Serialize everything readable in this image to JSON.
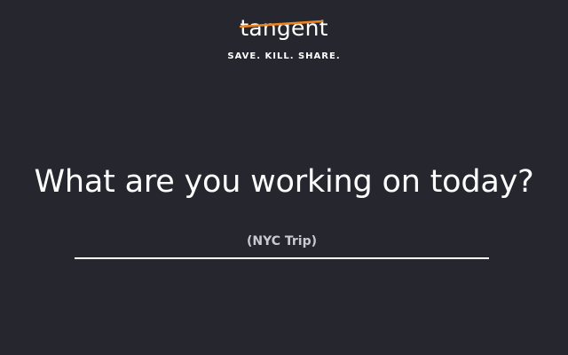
{
  "brand": {
    "name": "tangent",
    "tagline": "SAVE. KILL. SHARE.",
    "accent_color": "#f0851f"
  },
  "prompt": {
    "question": "What are you working on today?"
  },
  "task_input": {
    "value": "",
    "placeholder": "(NYC Trip)"
  },
  "colors": {
    "background": "#26262f",
    "text": "#ffffff"
  }
}
